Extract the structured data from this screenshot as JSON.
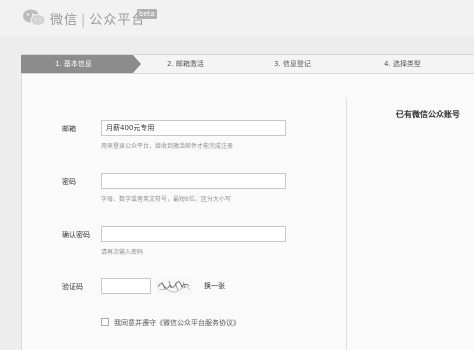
{
  "header": {
    "brand": "微信",
    "separator": "|",
    "platform": "公众平台",
    "badge": "beta"
  },
  "steps": [
    {
      "label": "1. 基本信息",
      "active": true
    },
    {
      "label": "2. 邮箱激活",
      "active": false
    },
    {
      "label": "3. 信息登记",
      "active": false
    },
    {
      "label": "4. 选择类型",
      "active": false
    }
  ],
  "form": {
    "email": {
      "label": "邮箱",
      "value": "月薪400元专用",
      "hint": "用来登录公众平台，接收到激活邮件才能完成注册"
    },
    "password": {
      "label": "密码",
      "value": "",
      "hint": "字母、数字或者英文符号，最短6位，区分大小写"
    },
    "confirm_password": {
      "label": "确认密码",
      "value": "",
      "hint": "请再次输入密码"
    },
    "captcha": {
      "label": "验证码",
      "value": "",
      "refresh_label": "换一张"
    },
    "agreement": {
      "label": "我同意并遵守《微信公众平台服务协议》",
      "checked": false
    }
  },
  "side": {
    "title": "已有微信公众账号"
  },
  "colors": {
    "header_bg": "#f2f2f2",
    "active_step_bg": "#8c8c8c",
    "page_bg": "#ededed",
    "panel_bg": "#fafafa"
  }
}
